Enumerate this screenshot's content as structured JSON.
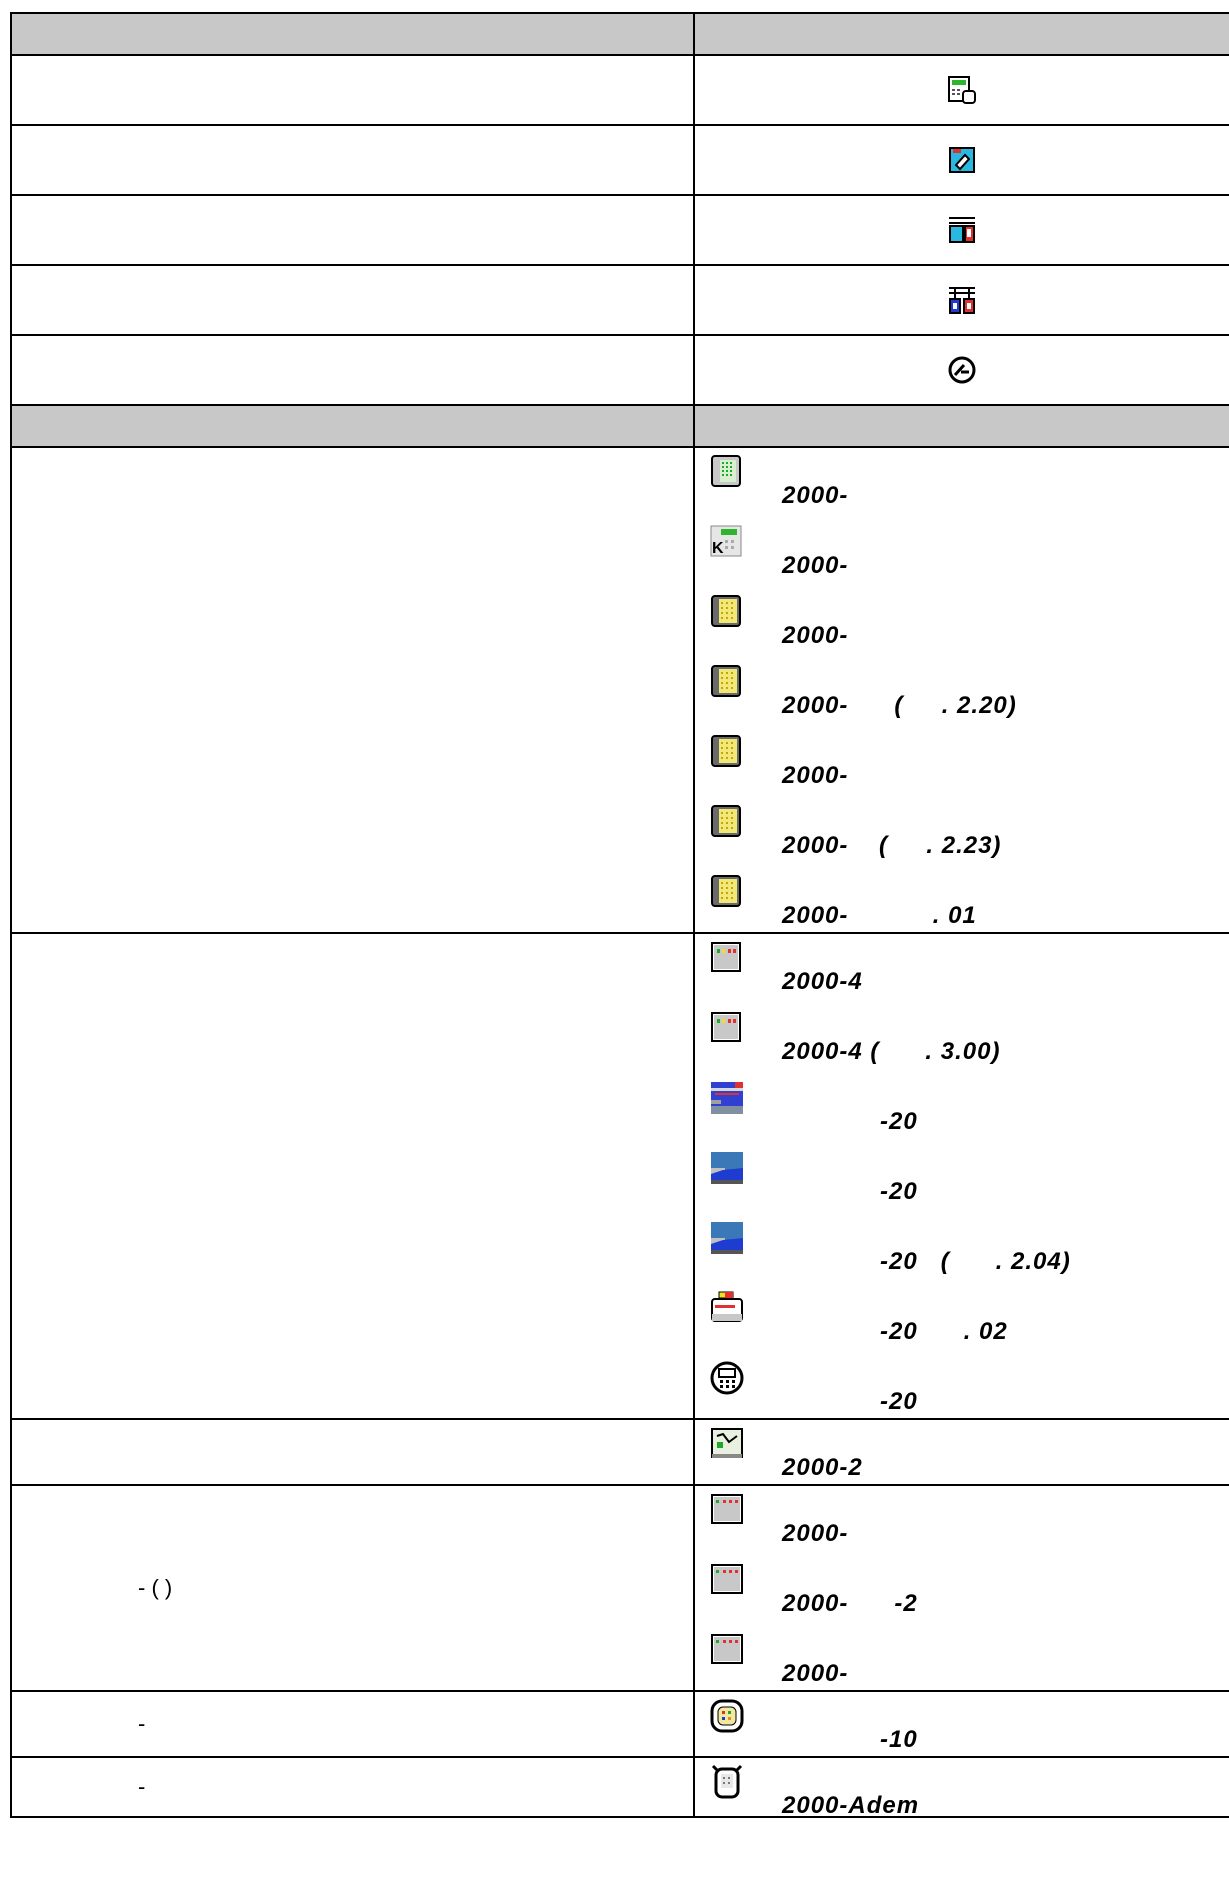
{
  "rows_simple": [
    {
      "icon": "terminal-camera-icon"
    },
    {
      "icon": "cyan-sensor-icon"
    },
    {
      "icon": "cyan-red-module-icon"
    },
    {
      "icon": "blue-red-module-icon"
    },
    {
      "icon": "circle-slash-icon"
    }
  ],
  "group1": [
    {
      "icon": "green-grid-panel-icon",
      "label": "2000-"
    },
    {
      "icon": "keyboard-panel-icon",
      "label": "2000-"
    },
    {
      "icon": "yellow-grid-panel-icon",
      "label": "2000-"
    },
    {
      "icon": "yellow-grid-panel-icon",
      "label": "2000-      (     . 2.20)"
    },
    {
      "icon": "yellow-grid-panel-icon",
      "label": "2000-"
    },
    {
      "icon": "yellow-grid-panel-icon",
      "label": "2000-    (     . 2.23)"
    },
    {
      "icon": "yellow-grid-panel-icon",
      "label": "2000-           . 01"
    }
  ],
  "group2": [
    {
      "icon": "gray-box-leds-icon",
      "label": "2000-4"
    },
    {
      "icon": "gray-box-leds-icon",
      "label": "2000-4 (      . 3.00)"
    },
    {
      "icon": "blue-striped-panel-icon",
      "label": "-20"
    },
    {
      "icon": "blue-wave-panel-icon",
      "label": "-20"
    },
    {
      "icon": "blue-wave-panel-icon",
      "label": "-20   (      . 2.04)"
    },
    {
      "icon": "printer-red-icon",
      "label": "-20      . 02"
    },
    {
      "icon": "round-keypad-icon",
      "label": "-20"
    }
  ],
  "group3": [
    {
      "icon": "diagram-panel-icon",
      "label": "2000-2"
    }
  ],
  "group4": {
    "left_text": "-                                      (     )",
    "items": [
      {
        "icon": "red-led-box-icon",
        "label": "2000-"
      },
      {
        "icon": "red-led-box-icon",
        "label": "2000-      -2"
      },
      {
        "icon": "red-led-box-icon",
        "label": "2000-"
      }
    ]
  },
  "group5": {
    "left_text": "-",
    "items": [
      {
        "icon": "round-module-icon",
        "label": "-10"
      }
    ]
  },
  "group6": {
    "left_text": "-",
    "items": [
      {
        "icon": "adem-device-icon",
        "label": "2000-Adem"
      }
    ]
  }
}
